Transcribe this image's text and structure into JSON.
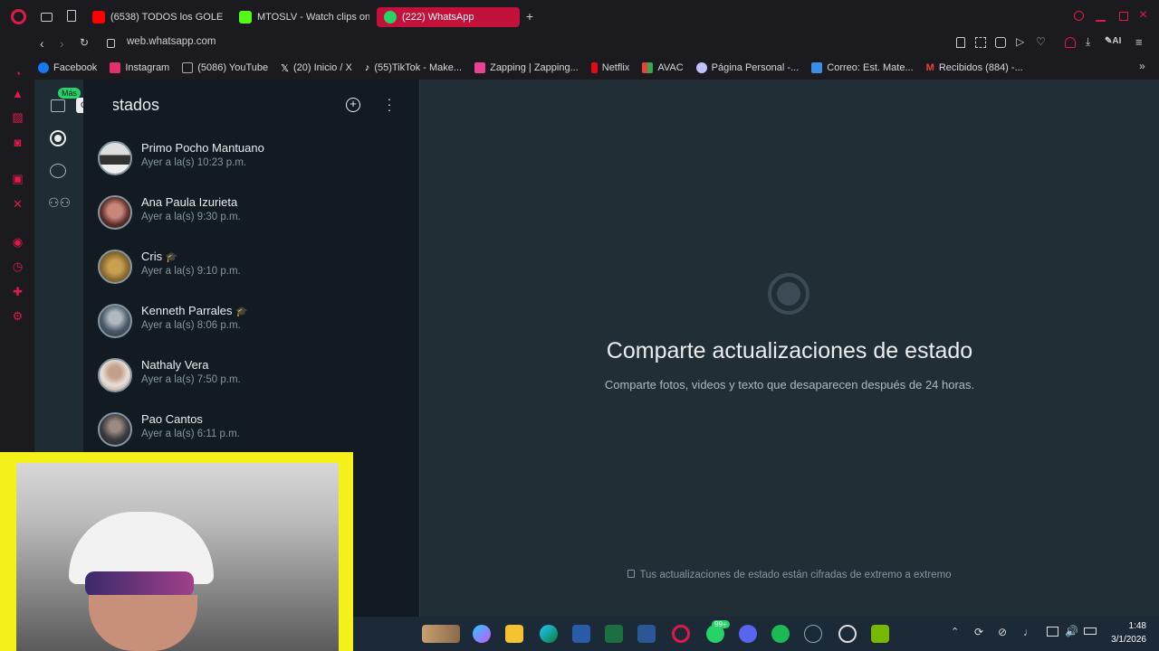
{
  "browser": {
    "tabs": [
      {
        "label": "(6538) TODOS los GOLES",
        "color": "#ff0000"
      },
      {
        "label": "MTOSLV - Watch clips on",
        "color": "#53fc18"
      },
      {
        "label": "(222) WhatsApp",
        "color": "#25d366"
      }
    ],
    "url": "web.whatsapp.com",
    "bookmarks": [
      {
        "label": "Facebook",
        "color": "#1877f2"
      },
      {
        "label": "Instagram",
        "color": "#e1306c"
      },
      {
        "label": "(5086) YouTube",
        "color": "#aaaaaa"
      },
      {
        "label": "(20) Inicio / X",
        "color": "#ffffff"
      },
      {
        "label": "(55)TikTok - Make...",
        "color": "#ffffff"
      },
      {
        "label": "Zapping | Zapping...",
        "color": "#e84393"
      },
      {
        "label": "Netflix",
        "color": "#e50914"
      },
      {
        "label": "AVAC",
        "color": "#f4b400"
      },
      {
        "label": "Página Personal -...",
        "color": "#c0c0ff"
      },
      {
        "label": "Correo: Est. Mate...",
        "color": "#3a8eea"
      },
      {
        "label": "Recibidos (884) -...",
        "color": "#ea4335"
      }
    ]
  },
  "whatsapp": {
    "rail": {
      "badge": "Más",
      "tooltip": "Chats"
    },
    "list_title": "Estados",
    "contacts": [
      {
        "name": "Primo Pocho Mantuano",
        "time": "Ayer a la(s) 10:23 p.m.",
        "emoji": ""
      },
      {
        "name": "Ana Paula Izurieta",
        "time": "Ayer a la(s) 9:30 p.m.",
        "emoji": ""
      },
      {
        "name": "Cris",
        "time": "Ayer a la(s) 9:10 p.m.",
        "emoji": "🎓"
      },
      {
        "name": "Kenneth Parrales",
        "time": "Ayer a la(s) 8:06 p.m.",
        "emoji": "🎓"
      },
      {
        "name": "Nathaly Vera",
        "time": "Ayer a la(s) 7:50 p.m.",
        "emoji": ""
      },
      {
        "name": "Pao Cantos",
        "time": "Ayer a la(s) 6:11 p.m.",
        "emoji": ""
      }
    ],
    "main": {
      "title": "Comparte actualizaciones de estado",
      "subtitle": "Comparte fotos, videos y texto que desaparecen después de 24 horas.",
      "footer": "Tus actualizaciones de estado están cifradas de extremo a extremo"
    }
  },
  "taskbar": {
    "time": "1:48",
    "date": "3/1/2026",
    "whatsapp_badge": "99+"
  },
  "colors": {
    "accent": "#c2113a",
    "wa_bg": "#111b21",
    "wa_panel": "#222e35"
  }
}
